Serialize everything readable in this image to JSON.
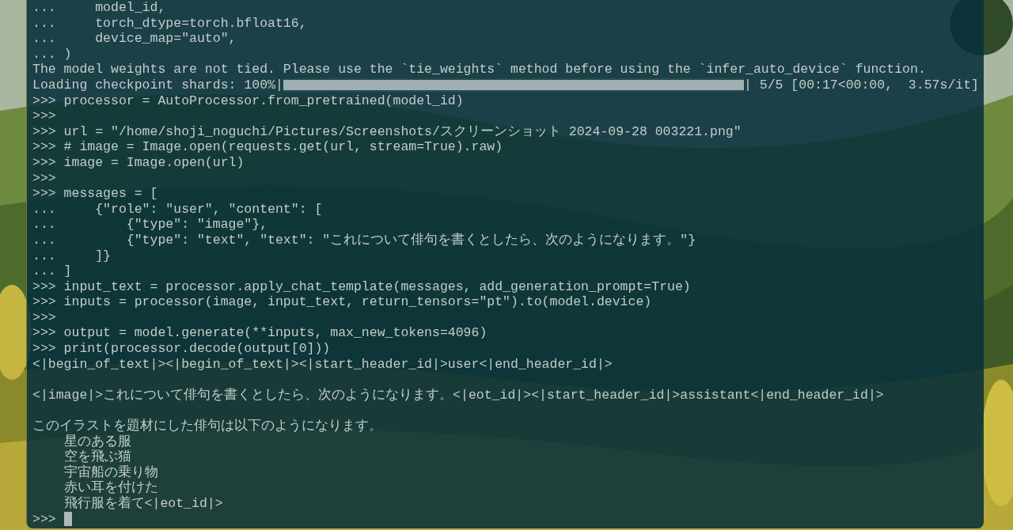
{
  "terminal": {
    "lines": [
      {
        "kind": "text",
        "text": "...     model_id,"
      },
      {
        "kind": "text",
        "text": "...     torch_dtype=torch.bfloat16,"
      },
      {
        "kind": "text",
        "text": "...     device_map=\"auto\","
      },
      {
        "kind": "text",
        "text": "... )"
      },
      {
        "kind": "text",
        "text": "The model weights are not tied. Please use the `tie_weights` method before using the `infer_auto_device` function."
      },
      {
        "kind": "progress",
        "label": "Loading checkpoint shards: 100%|",
        "level": 1,
        "status": "| 5/5 [00:17<00:00,  3.57s/it]"
      },
      {
        "kind": "text",
        "text": ">>> processor = AutoProcessor.from_pretrained(model_id)"
      },
      {
        "kind": "text",
        "text": ">>>"
      },
      {
        "kind": "text",
        "text": ">>> url = \"/home/shoji_noguchi/Pictures/Screenshots/スクリーンショット 2024-09-28 003221.png\""
      },
      {
        "kind": "text",
        "text": ">>> # image = Image.open(requests.get(url, stream=True).raw)"
      },
      {
        "kind": "text",
        "text": ">>> image = Image.open(url)"
      },
      {
        "kind": "text",
        "text": ">>>"
      },
      {
        "kind": "text",
        "text": ">>> messages = ["
      },
      {
        "kind": "text",
        "text": "...     {\"role\": \"user\", \"content\": ["
      },
      {
        "kind": "text",
        "text": "...         {\"type\": \"image\"},"
      },
      {
        "kind": "text",
        "text": "...         {\"type\": \"text\", \"text\": \"これについて俳句を書くとしたら、次のようになります。\"}"
      },
      {
        "kind": "text",
        "text": "...     ]}"
      },
      {
        "kind": "text",
        "text": "... ]"
      },
      {
        "kind": "text",
        "text": ">>> input_text = processor.apply_chat_template(messages, add_generation_prompt=True)"
      },
      {
        "kind": "text",
        "text": ">>> inputs = processor(image, input_text, return_tensors=\"pt\").to(model.device)"
      },
      {
        "kind": "text",
        "text": ">>>"
      },
      {
        "kind": "text",
        "text": ">>> output = model.generate(**inputs, max_new_tokens=4096)"
      },
      {
        "kind": "text",
        "text": ">>> print(processor.decode(output[0]))"
      },
      {
        "kind": "text",
        "text": "<|begin_of_text|><|begin_of_text|><|start_header_id|>user<|end_header_id|>"
      },
      {
        "kind": "blank"
      },
      {
        "kind": "text",
        "text": "<|image|>これについて俳句を書くとしたら、次のようになります。<|eot_id|><|start_header_id|>assistant<|end_header_id|>"
      },
      {
        "kind": "blank"
      },
      {
        "kind": "text",
        "text": "このイラストを題材にした俳句は以下のようになります。"
      },
      {
        "kind": "text",
        "text": "    星のある服"
      },
      {
        "kind": "text",
        "text": "    空を飛ぶ猫"
      },
      {
        "kind": "text",
        "text": "    宇宙船の乗り物"
      },
      {
        "kind": "text",
        "text": "    赤い耳を付けた"
      },
      {
        "kind": "text",
        "text": "    飛行服を着て<|eot_id|>"
      },
      {
        "kind": "prompt",
        "text": ">>>"
      }
    ]
  }
}
